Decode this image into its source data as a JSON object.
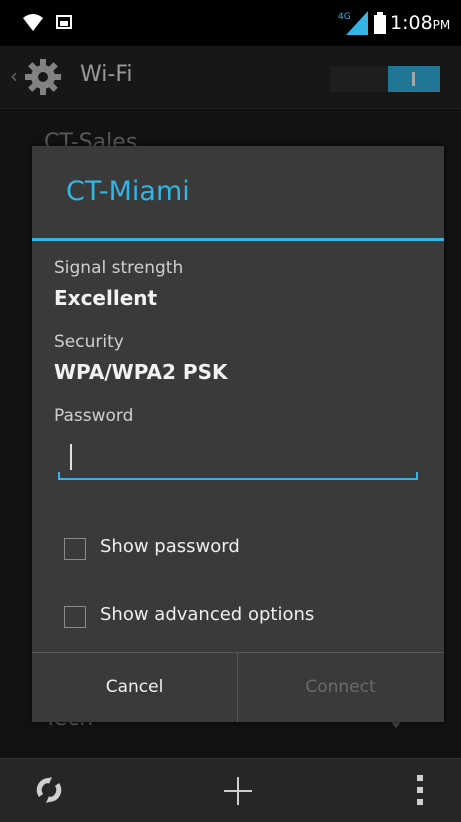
{
  "status_bar": {
    "network_badge": "4G",
    "time": "1:08",
    "ampm": "PM",
    "icons": [
      "wifi-icon",
      "screenshot-icon",
      "signal-icon",
      "battery-icon"
    ]
  },
  "action_bar": {
    "title": "Wi-Fi",
    "toggle_on": true,
    "icons": [
      "back-chevron-icon",
      "settings-gear-icon"
    ]
  },
  "background_list": {
    "items": [
      "CT-Sales",
      "Tech"
    ]
  },
  "dialog": {
    "title": "CT-Miami",
    "signal_label": "Signal strength",
    "signal_value": "Excellent",
    "security_label": "Security",
    "security_value": "WPA/WPA2 PSK",
    "password_label": "Password",
    "password_value": "",
    "show_password_label": "Show password",
    "show_password_checked": false,
    "show_advanced_label": "Show advanced options",
    "show_advanced_checked": false,
    "cancel_label": "Cancel",
    "connect_label": "Connect"
  },
  "bottom_bar": {
    "icons": [
      "wps-icon",
      "add-network-icon",
      "overflow-menu-icon"
    ]
  },
  "colors": {
    "accent": "#33b5e5",
    "dialog_bg": "#3a3a3a",
    "screen_bg": "#1c1c1c",
    "disabled_text": "#6a6a6a"
  }
}
